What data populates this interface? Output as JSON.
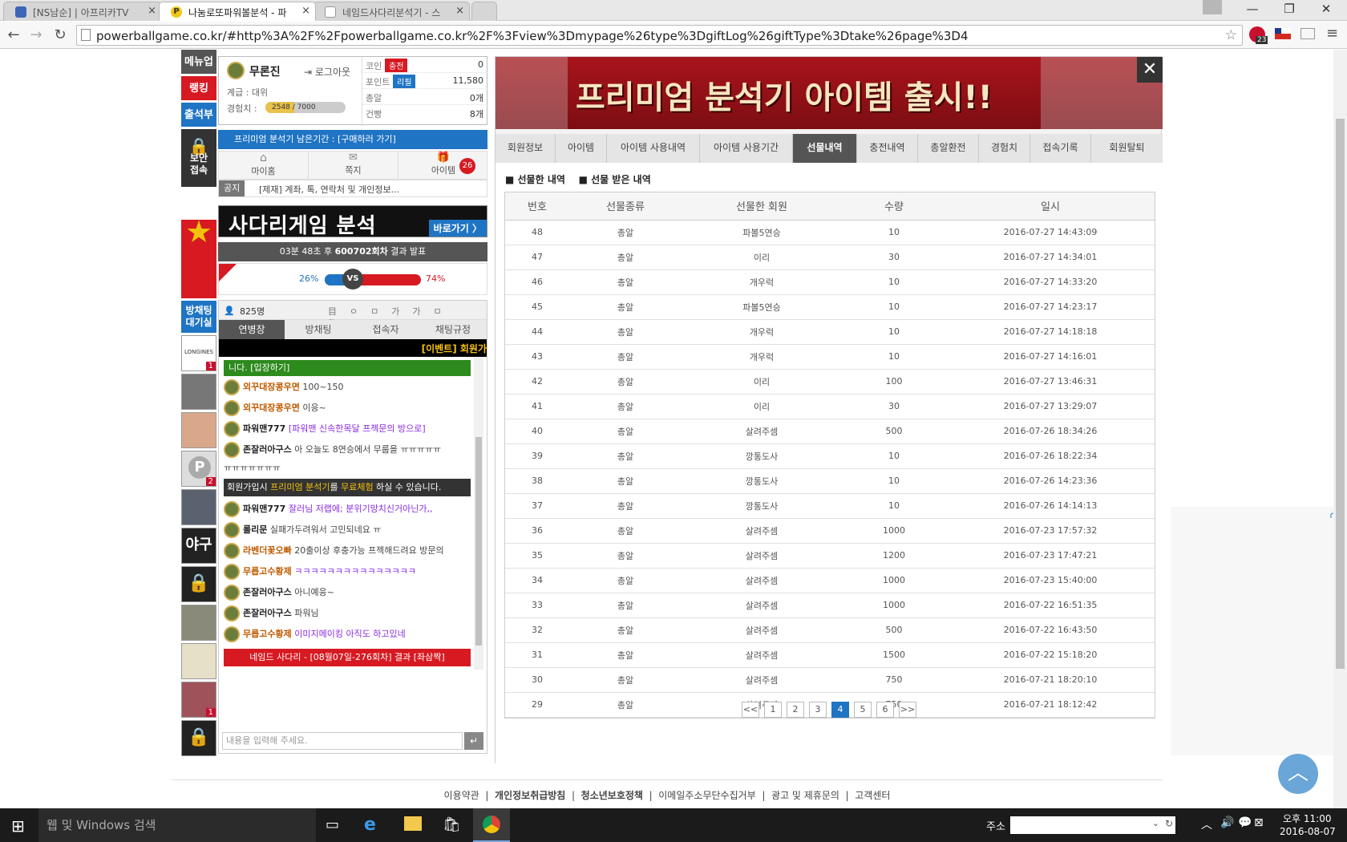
{
  "browser": {
    "tabs": [
      {
        "label": "[NS남순] | 아프리카TV",
        "active": false
      },
      {
        "label": "나눔로또파워볼분석 - 파",
        "active": true
      },
      {
        "label": "네임드사다리분석기 - 스",
        "active": false
      }
    ],
    "url": "powerballgame.co.kr/#http%3A%2F%2Fpowerballgame.co.kr%2F%3Fview%3Dmypage%26type%3DgiftLog%26giftType%3Dtake%26page%3D4",
    "ext_badge": "23"
  },
  "leftbar": {
    "menu_up": "메뉴업",
    "ranking": "랭킹",
    "attendance": "출석부",
    "secure": "보안접속",
    "waiting_room": "방채팅대기실",
    "thumb_badges": [
      "1",
      "2",
      "1"
    ],
    "baseball": "야구"
  },
  "user": {
    "name": "무론진",
    "logout": "로그아웃",
    "rank_label": "계급 : 대위",
    "exp_label": "경험치 :",
    "exp_value": "2548 / 7000",
    "exp_fraction": 0.364,
    "stats": [
      {
        "label": "코인",
        "btn": "충전",
        "value": "0"
      },
      {
        "label": "포인트",
        "btn": "리필",
        "value": "11,580"
      },
      {
        "label": "총알",
        "btn": "",
        "value": "0개"
      },
      {
        "label": "건빵",
        "btn": "",
        "value": "8개"
      }
    ],
    "premium_notice": "프리미엄 분석기 남은기간 : [구매하러 가기]",
    "quick": [
      {
        "label": "마이홈",
        "icon": "home-icon"
      },
      {
        "label": "쪽지",
        "icon": "mail-icon"
      },
      {
        "label": "아이템",
        "icon": "gift-icon"
      }
    ],
    "item_badge": "26",
    "notice_tag": "공지",
    "notice_text": "[제재] 계좌, 톡, 연락처 및 개인정보..."
  },
  "banner_sadari": {
    "title": "사다리게임 분석",
    "link": "바로가기 〉"
  },
  "countdown": {
    "text_pre": "03분 48초 후 ",
    "round": "600702회차",
    "text_post": " 결과 발표"
  },
  "vote": {
    "left": "26%",
    "vs": "VS",
    "right": "74%",
    "left_fraction": 0.26
  },
  "chat": {
    "count": "825명",
    "tools": [
      "目ㅇ",
      "ㅁ",
      "가",
      "가",
      "ㅁ",
      "⇅",
      "◁×"
    ],
    "tabs": [
      "연병장",
      "방채팅",
      "접속자",
      "채팅규정"
    ],
    "ticker": "[이벤트] 회원가",
    "enter_msg": "니다. [입장하기]",
    "lines": [
      {
        "nick": "외꾸대장콩우면",
        "msg": "100~150",
        "style": "o"
      },
      {
        "nick": "외꾸대장콩우면",
        "msg": "이응~",
        "style": "o"
      },
      {
        "nick": "파워맨777",
        "msg": "[파워맨 신속한목달 프젝문의 방으로]",
        "style": "b",
        "msgstyle": "p"
      },
      {
        "nick": "존잘러아구스",
        "msg": "아 오늘도 8연승에서 무룹을 ㅠㅠㅠㅠㅠ",
        "style": "b"
      },
      {
        "nick": "",
        "msg": "ㅠㅠㅠㅠㅠㅠㅠ",
        "style": ""
      },
      {
        "nick": "파워맨777",
        "msg": "잘러님 저랩에; 분위기망치신거아닌가,,",
        "style": "b",
        "msgstyle": "p"
      },
      {
        "nick": "롤리문",
        "msg": "실패가두려워서 고민되네요 ㅠ",
        "style": "b"
      },
      {
        "nick": "라벤더꽃오빠",
        "msg": "20출이상 후충가능 프젝해드려요 방문의",
        "style": "o"
      },
      {
        "nick": "무릅고수황제",
        "msg": "ㅋㅋㅋㅋㅋㅋㅋㅋㅋㅋㅋㅋㅋㅋㅋ",
        "style": "o",
        "msgstyle": "p"
      },
      {
        "nick": "존잘러아구스",
        "msg": "아니예응~",
        "style": "b"
      },
      {
        "nick": "존잘러아구스",
        "msg": "파워님",
        "style": "b"
      },
      {
        "nick": "무릅고수황제",
        "msg": "이미지메이킹 아직도 하고있네",
        "style": "o",
        "msgstyle": "p"
      }
    ],
    "promo_pre": "회원가입시 ",
    "promo_hl": "프리미엄 분석기",
    "promo_mid": "를 ",
    "promo_hl2": "무료체험",
    "promo_post": " 하실 수 있습니다.",
    "result_msg": "네임드 사다리 - [08월07일-276회차] 결과 [좌삼짝]",
    "input_placeholder": "내용을 입력해 주세요."
  },
  "main": {
    "banner": "프리미엄 분석기 아이템 출시!!",
    "tabs": [
      "회원정보",
      "아이템",
      "아이템 사용내역",
      "아이템 사용기간",
      "선물내역",
      "충전내역",
      "총알환전",
      "경험치",
      "접속기록",
      "회원탈퇴"
    ],
    "active_tab": "선물내역",
    "subtabs": [
      "선물한 내역",
      "선물 받은 내역"
    ],
    "columns": [
      "번호",
      "선물종류",
      "선물한 회원",
      "수량",
      "일시"
    ],
    "rows": [
      [
        "48",
        "총알",
        "파볼5연승",
        "10",
        "2016-07-27 14:43:09"
      ],
      [
        "47",
        "총알",
        "이리",
        "30",
        "2016-07-27 14:34:01"
      ],
      [
        "46",
        "총알",
        "개우럭",
        "10",
        "2016-07-27 14:33:20"
      ],
      [
        "45",
        "총알",
        "파볼5연승",
        "10",
        "2016-07-27 14:23:17"
      ],
      [
        "44",
        "총알",
        "개우럭",
        "10",
        "2016-07-27 14:18:18"
      ],
      [
        "43",
        "총알",
        "개우럭",
        "10",
        "2016-07-27 14:16:01"
      ],
      [
        "42",
        "총알",
        "이리",
        "100",
        "2016-07-27 13:46:31"
      ],
      [
        "41",
        "총알",
        "이리",
        "30",
        "2016-07-27 13:29:07"
      ],
      [
        "40",
        "총알",
        "살려주셈",
        "500",
        "2016-07-26 18:34:26"
      ],
      [
        "39",
        "총알",
        "깡통도사",
        "10",
        "2016-07-26 18:22:34"
      ],
      [
        "38",
        "총알",
        "깡통도사",
        "10",
        "2016-07-26 14:23:36"
      ],
      [
        "37",
        "총알",
        "깡통도사",
        "10",
        "2016-07-26 14:14:13"
      ],
      [
        "36",
        "총알",
        "살려주셈",
        "1000",
        "2016-07-23 17:57:32"
      ],
      [
        "35",
        "총알",
        "살려주셈",
        "1200",
        "2016-07-23 17:47:21"
      ],
      [
        "34",
        "총알",
        "살려주셈",
        "1000",
        "2016-07-23 15:40:00"
      ],
      [
        "33",
        "총알",
        "살려주셈",
        "1000",
        "2016-07-22 16:51:35"
      ],
      [
        "32",
        "총알",
        "살려주셈",
        "500",
        "2016-07-22 16:43:50"
      ],
      [
        "31",
        "총알",
        "살려주셈",
        "1500",
        "2016-07-22 15:18:20"
      ],
      [
        "30",
        "총알",
        "살려주셈",
        "750",
        "2016-07-21 18:20:10"
      ],
      [
        "29",
        "총알",
        "살려주셈",
        "750",
        "2016-07-21 18:12:42"
      ]
    ],
    "pagination": [
      "<<",
      "1",
      "2",
      "3",
      "4",
      "5",
      "6",
      ">>"
    ],
    "current_page": "4"
  },
  "footer": {
    "links": [
      "이용약관",
      "개인정보취급방침",
      "청소년보호정책",
      "이메일주소무단수집거부",
      "광고 및 제휴문의",
      "고객센터"
    ]
  },
  "taskbar": {
    "search": "웹 및 Windows 검색",
    "address_label": "주소",
    "time": "오후 11:00",
    "date": "2016-08-07"
  },
  "colors": {
    "accent": "#1f74c4",
    "red": "#c8102e",
    "dark": "#555555",
    "green": "#2d8a1d"
  }
}
